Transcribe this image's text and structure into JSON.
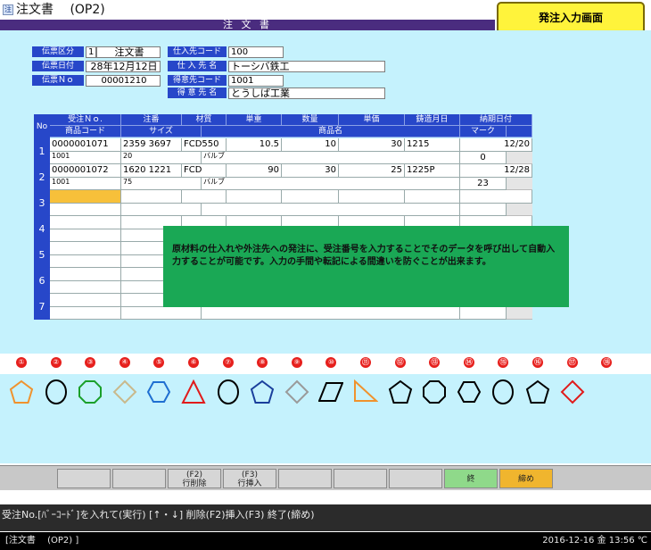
{
  "window": {
    "app_icon": "注",
    "title": "注文書　 (OP2)",
    "screen_button": "発注入力画面",
    "header_bar": "注 文 書"
  },
  "header_left": [
    {
      "label": "伝票区分",
      "value": "1",
      "value2": "注文書"
    },
    {
      "label": "伝票日付",
      "value": "28年12月12日"
    },
    {
      "label": "伝票Ｎｏ",
      "value": "00001210"
    }
  ],
  "header_right": [
    {
      "label": "仕入先コード",
      "value": "100"
    },
    {
      "label": "仕 入 先 名",
      "value": "トーシバ鉄工"
    },
    {
      "label": "得意先コード",
      "value": "1001"
    },
    {
      "label": "得 意 先 名",
      "value": "とうしば工業"
    }
  ],
  "table": {
    "no_header": "No",
    "row1_headers": [
      "受注Ｎｏ.",
      "注番",
      "材質",
      "単重",
      "数量",
      "単価",
      "鋳造月日",
      "納期日付"
    ],
    "row2_headers": [
      "商品コード",
      "サイズ",
      "商品名",
      "マーク"
    ],
    "rows": [
      {
        "no": "1",
        "order_no": "0000001071",
        "chuban": "2359 3697",
        "material": "FCD550",
        "unit_weight": "10.5",
        "quantity": "10",
        "unit_price": "30",
        "cast_date": "1215",
        "due_date": "12/20",
        "product_code": "1001",
        "size": "20",
        "product_name": "バルブ",
        "mark": "0"
      },
      {
        "no": "2",
        "order_no": "0000001072",
        "chuban": "1620 1221",
        "material": "FCD",
        "unit_weight": "90",
        "quantity": "30",
        "unit_price": "25",
        "cast_date": "1225P",
        "due_date": "12/28",
        "product_code": "1001",
        "size": "75",
        "product_name": "バルブ",
        "mark": "23"
      },
      {
        "no": "3",
        "order_no": "",
        "chuban": "",
        "material": "",
        "unit_weight": "",
        "quantity": "",
        "unit_price": "",
        "cast_date": "",
        "due_date": "",
        "product_code": "",
        "size": "",
        "product_name": "",
        "mark": ""
      },
      {
        "no": "4",
        "order_no": "",
        "chuban": "",
        "material": "",
        "unit_weight": "",
        "quantity": "",
        "unit_price": "",
        "cast_date": "",
        "due_date": "",
        "product_code": "",
        "size": "",
        "product_name": "",
        "mark": ""
      },
      {
        "no": "5",
        "order_no": "",
        "chuban": "",
        "material": "",
        "unit_weight": "",
        "quantity": "",
        "unit_price": "",
        "cast_date": "",
        "due_date": "",
        "product_code": "",
        "size": "",
        "product_name": "",
        "mark": ""
      },
      {
        "no": "6",
        "order_no": "",
        "chuban": "",
        "material": "",
        "unit_weight": "",
        "quantity": "",
        "unit_price": "",
        "cast_date": "",
        "due_date": "",
        "product_code": "",
        "size": "",
        "product_name": "",
        "mark": ""
      },
      {
        "no": "7",
        "order_no": "",
        "chuban": "",
        "material": "",
        "unit_weight": "",
        "quantity": "",
        "unit_price": "",
        "cast_date": "",
        "due_date": "",
        "product_code": "",
        "size": "",
        "product_name": "",
        "mark": ""
      }
    ]
  },
  "note": "原材料の仕入れや外注先への発注に、受注番号を入力することでそのデータを呼び出して自動入力することが可能です。入力の手間や転記による間違いを防ぐことが出来ます。",
  "shapes": [
    {
      "n": "①",
      "icon": "pentagon-icon",
      "color": "#f0922d"
    },
    {
      "n": "②",
      "icon": "circle-icon",
      "color": "#000000"
    },
    {
      "n": "③",
      "icon": "octagon-icon",
      "color": "#1aa02a"
    },
    {
      "n": "④",
      "icon": "diamond-icon",
      "color": "#c9b98c"
    },
    {
      "n": "⑤",
      "icon": "hexagon-icon",
      "color": "#1f6fd1"
    },
    {
      "n": "⑥",
      "icon": "triangle-icon",
      "color": "#e01b1b"
    },
    {
      "n": "⑦",
      "icon": "circle-icon",
      "color": "#000000"
    },
    {
      "n": "⑧",
      "icon": "pentagon-icon",
      "color": "#1a3f9c"
    },
    {
      "n": "⑨",
      "icon": "diamond-icon",
      "color": "#9a9a9a"
    },
    {
      "n": "⑩",
      "icon": "parallelogram-icon",
      "color": "#000000"
    },
    {
      "n": "⑪",
      "icon": "right-triangle-icon",
      "color": "#f0922d"
    },
    {
      "n": "⑫",
      "icon": "pentagon-icon",
      "color": "#000000"
    },
    {
      "n": "⑬",
      "icon": "octagon-icon",
      "color": "#000000"
    },
    {
      "n": "⑭",
      "icon": "hexagon-icon",
      "color": "#000000"
    },
    {
      "n": "⑮",
      "icon": "circle-icon",
      "color": "#000000"
    },
    {
      "n": "⑯",
      "icon": "pentagon-icon",
      "color": "#000000"
    },
    {
      "n": "⑰",
      "icon": "diamond-icon",
      "color": "#e01b1b"
    },
    {
      "n": "⑱",
      "icon": "",
      "color": ""
    }
  ],
  "function_keys": [
    {
      "label": "",
      "bg": "#d6d6d6"
    },
    {
      "label": "",
      "bg": "#d6d6d6"
    },
    {
      "label": "(F2)\n行削除",
      "bg": "#d6d6d6"
    },
    {
      "label": "(F3)\n行挿入",
      "bg": "#d6d6d6"
    },
    {
      "label": "",
      "bg": "#d6d6d6"
    },
    {
      "label": "",
      "bg": "#d6d6d6"
    },
    {
      "label": "",
      "bg": "#d6d6d6"
    },
    {
      "label": "終",
      "bg": "#8fd98a"
    },
    {
      "label": "締め",
      "bg": "#f0b52e"
    }
  ],
  "status_line": "受注No.[ﾊﾞｰｺｰﾄﾞ]を入れて(実行) [↑・↓] 削除(F2)挿入(F3) 終了(締め)",
  "bottom": {
    "left": "[注文書　 (OP2) ]",
    "right": "2016-12-16 金 13:56 ℃"
  }
}
